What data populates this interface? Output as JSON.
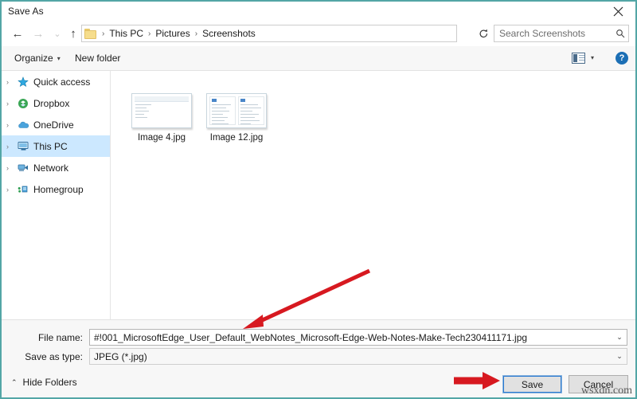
{
  "window": {
    "title": "Save As",
    "close_label": "✕"
  },
  "nav": {
    "back_icon": "←",
    "forward_icon": "→",
    "history_icon": "⌄",
    "up_icon": "↑",
    "breadcrumbs": [
      "This PC",
      "Pictures",
      "Screenshots"
    ],
    "separator": "›",
    "dropdown_icon": "⌄",
    "refresh_icon": "↻"
  },
  "search": {
    "placeholder": "Search Screenshots",
    "icon": "⚲"
  },
  "command_bar": {
    "organize_label": "Organize",
    "organize_caret": "▾",
    "new_folder_label": "New folder",
    "view_caret": "▾",
    "help_label": "?"
  },
  "sidebar": {
    "items": [
      {
        "label": "Quick access",
        "icon": "star-icon",
        "selected": false
      },
      {
        "label": "Dropbox",
        "icon": "dropbox-icon",
        "selected": false
      },
      {
        "label": "OneDrive",
        "icon": "cloud-icon",
        "selected": false
      },
      {
        "label": "This PC",
        "icon": "monitor-icon",
        "selected": true
      },
      {
        "label": "Network",
        "icon": "network-icon",
        "selected": false
      },
      {
        "label": "Homegroup",
        "icon": "homegroup-icon",
        "selected": false
      }
    ],
    "expander_icon": "›"
  },
  "files": [
    {
      "name": "Image 4.jpg",
      "thumb": "document-preview"
    },
    {
      "name": "Image 12.jpg",
      "thumb": "two-pane-preview"
    }
  ],
  "form": {
    "filename_label": "File name:",
    "filename_value": "#!001_MicrosoftEdge_User_Default_WebNotes_Microsoft-Edge-Web-Notes-Make-Tech230411171.jpg",
    "savetype_label": "Save as type:",
    "savetype_value": "JPEG (*.jpg)",
    "dropdown_icon": "⌄"
  },
  "actions": {
    "hide_folders_label": "Hide Folders",
    "hide_folders_caret": "⌃",
    "save_label": "Save",
    "cancel_label": "Cancel"
  },
  "annotations": {
    "arrow_color": "#d71920",
    "watermark": "wsxdn.com"
  },
  "colors": {
    "accent_border": "#53a6a6",
    "selection": "#cce8ff",
    "focus_outline": "#2a7ad1",
    "help_blue": "#1c6fb5",
    "folder_yellow": "#f6dd8c"
  }
}
